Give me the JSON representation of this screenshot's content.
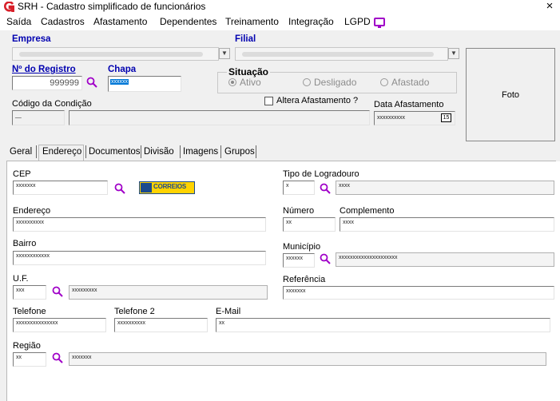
{
  "window": {
    "title": "SRH - Cadastro simplificado de funcionários",
    "close_glyph": "×"
  },
  "menu": {
    "items": [
      "Saída",
      "Cadastros",
      "Afastamento",
      "Dependentes",
      "Treinamento",
      "Integração",
      "LGPD"
    ]
  },
  "header": {
    "empresa_label": "Empresa",
    "filial_label": "Filial",
    "registro_label": "Nº do Registro",
    "registro_value": "999999",
    "chapa_label": "Chapa",
    "chapa_value": "xxxxxx",
    "situacao_label": "Situação",
    "situacao_options": [
      "Ativo",
      "Desligado",
      "Afastado"
    ],
    "situacao_selected": "Ativo",
    "codigo_condicao_label": "Código da Condição",
    "codigo_condicao_value": "__",
    "altera_afastamento_label": "Altera Afastamento ?",
    "data_afastamento_label": "Data Afastamento",
    "data_afastamento_value": "xxxxxxxxxx",
    "calendar_day": "15",
    "foto_label": "Foto"
  },
  "tabs": [
    "Geral",
    "Endereço",
    "Documentos",
    "Divisão",
    "Imagens",
    "Grupos"
  ],
  "active_tab": "Endereço",
  "address": {
    "cep_label": "CEP",
    "cep_value": "xxxxxxx",
    "correios_label": "CORREIOS",
    "tipo_logradouro_label": "Tipo de Logradouro",
    "tipo_logradouro_code": "x",
    "tipo_logradouro_desc": "xxxx",
    "endereco_label": "Endereço",
    "endereco_value": "xxxxxxxxxx",
    "numero_label": "Número",
    "numero_value": "xx",
    "complemento_label": "Complemento",
    "complemento_value": "xxxx",
    "bairro_label": "Bairro",
    "bairro_value": "xxxxxxxxxxxx",
    "municipio_label": "Município",
    "municipio_code": "xxxxxx",
    "municipio_desc": "xxxxxxxxxxxxxxxxxxxxx",
    "uf_label": "U.F.",
    "uf_code": "xxx",
    "uf_desc": "xxxxxxxxx",
    "referencia_label": "Referência",
    "referencia_value": "xxxxxxx",
    "telefone_label": "Telefone",
    "telefone_value": "xxxxxxxxxxxxxxx",
    "telefone2_label": "Telefone 2",
    "telefone2_value": "xxxxxxxxxx",
    "email_label": "E-Mail",
    "email_value": "xx",
    "regiao_label": "Região",
    "regiao_code": "xx",
    "regiao_desc": "xxxxxxx"
  },
  "icons": {
    "app": "app-logo-icon",
    "lgpd": "monitor-icon",
    "search": "magnifier-icon",
    "calendar": "calendar-icon"
  },
  "colors": {
    "label_blue": "#0000b0",
    "search_icon": "#a000c8",
    "app_icon_red": "#d8202a",
    "lgpd_icon": "#a000c8",
    "correios_yellow": "#ffd300",
    "correios_blue": "#1b4a8d"
  }
}
